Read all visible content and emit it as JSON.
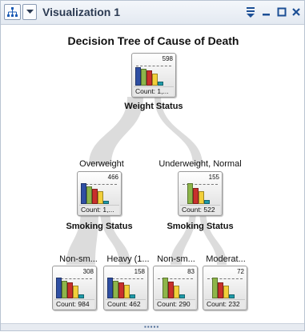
{
  "window": {
    "title": "Visualization 1",
    "icons": [
      "decision-tree-icon",
      "dropdown-icon",
      "filter-menu-icon",
      "minimize-icon",
      "maximize-icon",
      "close-icon"
    ]
  },
  "chart_data": {
    "type": "decision-tree",
    "title": "Decision Tree of Cause of Death",
    "bar_colors": [
      "#2f4fa3",
      "#8db54a",
      "#c9302c",
      "#f2cf3a",
      "#1f9aa8"
    ],
    "nodes": [
      {
        "id": "root",
        "label": "Weight Status",
        "max_value": "598",
        "count": "Count: 1,...",
        "bars": [
          0.9,
          0.82,
          0.72,
          0.58,
          0.18
        ]
      },
      {
        "id": "n1",
        "branch": "Overweight",
        "label": "Smoking Status",
        "max_value": "466",
        "count": "Count: 1,...",
        "bars": [
          1.0,
          0.85,
          0.72,
          0.6,
          0.17
        ]
      },
      {
        "id": "n2",
        "branch": "Underweight, Normal",
        "label": "Smoking Status",
        "max_value": "155",
        "count": "Count: 522",
        "bars": [
          0.0,
          1.0,
          0.78,
          0.62,
          0.2
        ]
      },
      {
        "id": "l1",
        "branch": "Non-sm...",
        "max_value": "308",
        "count": "Count: 984",
        "bars": [
          1.0,
          0.85,
          0.75,
          0.6,
          0.18
        ]
      },
      {
        "id": "l2",
        "branch": "Heavy (1...",
        "max_value": "158",
        "count": "Count: 462",
        "bars": [
          1.0,
          0.85,
          0.75,
          0.65,
          0.2
        ]
      },
      {
        "id": "l3",
        "branch": "Non-sm...",
        "max_value": "83",
        "count": "Count: 290",
        "bars": [
          0.0,
          1.0,
          0.8,
          0.6,
          0.2
        ]
      },
      {
        "id": "l4",
        "branch": "Moderat...",
        "max_value": "72",
        "count": "Count: 232",
        "bars": [
          0.0,
          1.0,
          0.75,
          0.6,
          0.2
        ]
      }
    ]
  }
}
